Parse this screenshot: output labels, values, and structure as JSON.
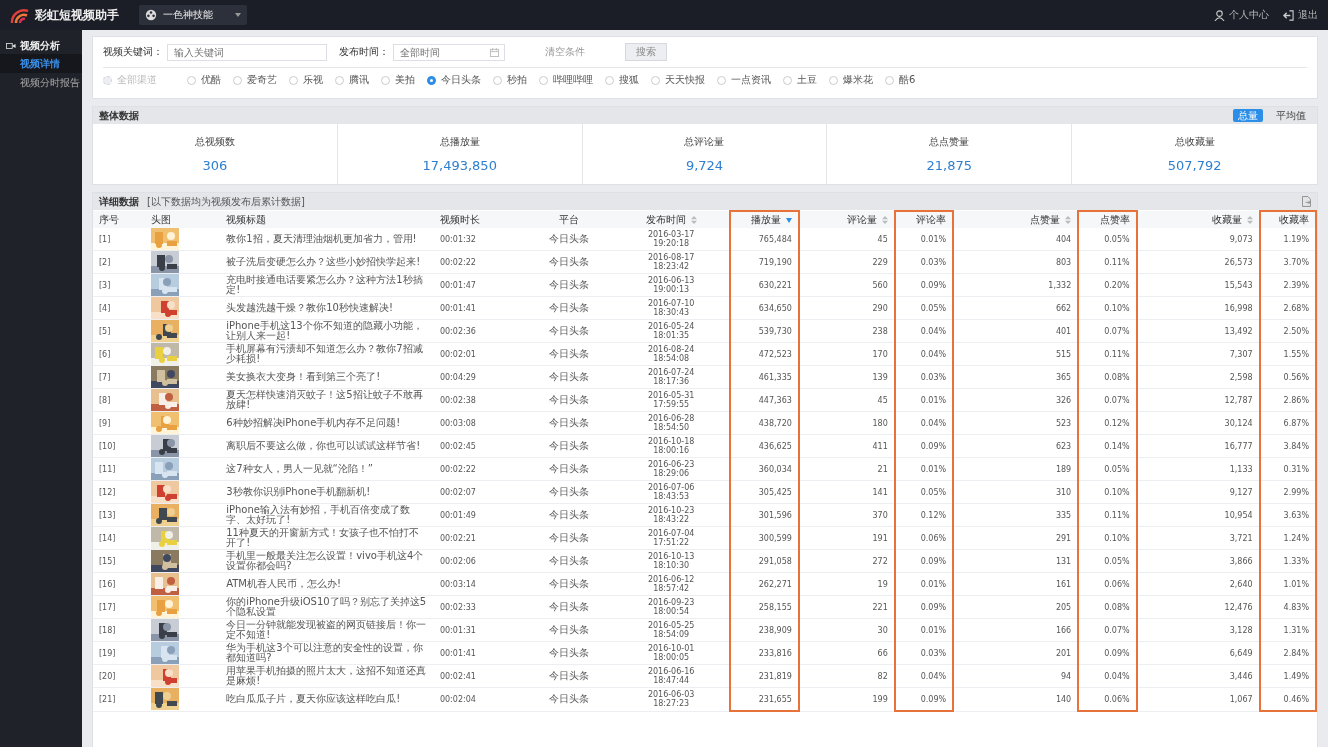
{
  "app": {
    "title": "彩虹短视频助手"
  },
  "account_select": {
    "value": "一色神技能"
  },
  "user_menu": [
    {
      "label": "个人中心",
      "kind": "user"
    },
    {
      "label": "退出",
      "kind": "logout"
    }
  ],
  "sidebar": {
    "section": "视频分析",
    "items": [
      {
        "label": "视频详情",
        "selected": true
      },
      {
        "label": "视频分时报告",
        "selected": false
      }
    ]
  },
  "filters": {
    "keyword_label": "视频关键词：",
    "keyword": {
      "placeholder": "输入关键词"
    },
    "date_label": "发布时间：",
    "date": {
      "placeholder": "全部时间"
    },
    "clear": "清空条件",
    "search": "搜索",
    "platforms": [
      {
        "label": "全部渠道",
        "selected": false,
        "disabled": true
      },
      {
        "label": "优酷",
        "selected": false,
        "disabled": false
      },
      {
        "label": "爱奇艺",
        "selected": false,
        "disabled": false
      },
      {
        "label": "乐视",
        "selected": false,
        "disabled": false
      },
      {
        "label": "腾讯",
        "selected": false,
        "disabled": false
      },
      {
        "label": "美拍",
        "selected": false,
        "disabled": false
      },
      {
        "label": "今日头条",
        "selected": true,
        "disabled": false
      },
      {
        "label": "秒拍",
        "selected": false,
        "disabled": false
      },
      {
        "label": "哔哩哔哩",
        "selected": false,
        "disabled": false
      },
      {
        "label": "搜狐",
        "selected": false,
        "disabled": false
      },
      {
        "label": "天天快报",
        "selected": false,
        "disabled": false
      },
      {
        "label": "一点资讯",
        "selected": false,
        "disabled": false
      },
      {
        "label": "土豆",
        "selected": false,
        "disabled": false
      },
      {
        "label": "爆米花",
        "selected": false,
        "disabled": false
      },
      {
        "label": "酷6",
        "selected": false,
        "disabled": false
      }
    ]
  },
  "overview": {
    "title": "整体数据",
    "modes": [
      {
        "label": "总量",
        "selected": true
      },
      {
        "label": "平均值",
        "selected": false
      }
    ],
    "stats": [
      {
        "label": "总视频数",
        "value": "306"
      },
      {
        "label": "总播放量",
        "value": "17,493,850"
      },
      {
        "label": "总评论量",
        "value": "9,724"
      },
      {
        "label": "总点赞量",
        "value": "21,875"
      },
      {
        "label": "总收藏量",
        "value": "507,792"
      }
    ]
  },
  "details": {
    "title": "详细数据",
    "note": "[以下数据均为视频发布后累计数据]",
    "columns": [
      {
        "label": "序号",
        "kind": "index",
        "highlighted": false
      },
      {
        "label": "头图",
        "kind": "thumb",
        "highlighted": false
      },
      {
        "label": "视频标题",
        "kind": "title",
        "highlighted": false
      },
      {
        "label": "视频时长",
        "kind": "text",
        "highlighted": false
      },
      {
        "label": "平台",
        "kind": "center",
        "highlighted": false
      },
      {
        "label": "发布时间",
        "kind": "date",
        "sortable": true,
        "sorted_desc": false,
        "highlighted": false
      },
      {
        "label": "播放量",
        "kind": "number",
        "sortable": true,
        "sorted_desc": true,
        "highlighted": true
      },
      {
        "label": "评论量",
        "kind": "number",
        "sortable": true,
        "sorted_desc": false,
        "highlighted": false
      },
      {
        "label": "评论率",
        "kind": "number",
        "highlighted": true
      },
      {
        "label": "点赞量",
        "kind": "number",
        "sortable": true,
        "sorted_desc": false,
        "highlighted": false
      },
      {
        "label": "点赞率",
        "kind": "number",
        "highlighted": true
      },
      {
        "label": "收藏量",
        "kind": "number",
        "sortable": true,
        "sorted_desc": false,
        "highlighted": false
      },
      {
        "label": "收藏率",
        "kind": "number",
        "highlighted": true
      }
    ],
    "rows": [
      {
        "cells": [
          "[1]",
          {
            "kind": "picture"
          },
          "教你1招，夏天清理油烟机更加省力，管用!",
          "00:01:32",
          "今日头条",
          "2016-03-17 19:20:18",
          "765,484",
          "45",
          "0.01%",
          "404",
          "0.05%",
          "9,073",
          "1.19%"
        ]
      },
      {
        "cells": [
          "[2]",
          {
            "kind": "picture"
          },
          "被子洗后变硬怎么办？这些小妙招快学起来!",
          "00:02:22",
          "今日头条",
          "2016-08-17 18:23:42",
          "719,190",
          "229",
          "0.03%",
          "803",
          "0.11%",
          "26,573",
          "3.70%"
        ]
      },
      {
        "cells": [
          "[3]",
          {
            "kind": "picture"
          },
          "充电时接通电话要紧怎么办？这种方法1秒搞定!",
          "00:01:47",
          "今日头条",
          "2016-06-13 19:00:13",
          "630,221",
          "560",
          "0.09%",
          "1,332",
          "0.20%",
          "15,543",
          "2.39%"
        ]
      },
      {
        "cells": [
          "[4]",
          {
            "kind": "picture"
          },
          "头发越洗越干燥？教你10秒快速解决!",
          "00:01:41",
          "今日头条",
          "2016-07-10 18:30:43",
          "634,650",
          "290",
          "0.05%",
          "662",
          "0.10%",
          "16,998",
          "2.68%"
        ]
      },
      {
        "cells": [
          "[5]",
          {
            "kind": "picture"
          },
          "iPhone手机这13个你不知道的隐藏小功能，让别人来一起!",
          "00:02:36",
          "今日头条",
          "2016-05-24 18:01:35",
          "539,730",
          "238",
          "0.04%",
          "401",
          "0.07%",
          "13,492",
          "2.50%"
        ]
      },
      {
        "cells": [
          "[6]",
          {
            "kind": "picture"
          },
          "手机屏幕有污渍却不知道怎么办？教你7招减少耗损!",
          "00:02:01",
          "今日头条",
          "2016-08-24 18:54:08",
          "472,523",
          "170",
          "0.04%",
          "515",
          "0.11%",
          "7,307",
          "1.55%"
        ]
      },
      {
        "cells": [
          "[7]",
          {
            "kind": "picture"
          },
          "美女换衣大变身！看到第三个亮了!",
          "00:04:29",
          "今日头条",
          "2016-07-24 18:17:36",
          "461,335",
          "139",
          "0.03%",
          "365",
          "0.08%",
          "2,598",
          "0.56%"
        ]
      },
      {
        "cells": [
          "[8]",
          {
            "kind": "picture"
          },
          "夏天怎样快速消灭蚊子！这5招让蚊子不敢再放肆!",
          "00:02:38",
          "今日头条",
          "2016-05-31 17:59:55",
          "447,363",
          "45",
          "0.01%",
          "326",
          "0.07%",
          "12,787",
          "2.86%"
        ]
      },
      {
        "cells": [
          "[9]",
          {
            "kind": "picture"
          },
          "6种妙招解决iPhone手机内存不足问题!",
          "00:03:08",
          "今日头条",
          "2016-06-28 18:54:50",
          "438,720",
          "180",
          "0.04%",
          "523",
          "0.12%",
          "30,124",
          "6.87%"
        ]
      },
      {
        "cells": [
          "[10]",
          {
            "kind": "picture"
          },
          "离职后不要这么做，你也可以试试这样节省!",
          "00:02:45",
          "今日头条",
          "2016-10-18 18:00:16",
          "436,625",
          "411",
          "0.09%",
          "623",
          "0.14%",
          "16,777",
          "3.84%"
        ]
      },
      {
        "cells": [
          "[11]",
          {
            "kind": "picture"
          },
          "这7种女人，男人一见就“沦陷！”",
          "00:02:22",
          "今日头条",
          "2016-06-23 18:29:06",
          "360,034",
          "21",
          "0.01%",
          "189",
          "0.05%",
          "1,133",
          "0.31%"
        ]
      },
      {
        "cells": [
          "[12]",
          {
            "kind": "picture"
          },
          "3秒教你识别iPhone手机翻新机!",
          "00:02:07",
          "今日头条",
          "2016-07-06 18:43:53",
          "305,425",
          "141",
          "0.05%",
          "310",
          "0.10%",
          "9,127",
          "2.99%"
        ]
      },
      {
        "cells": [
          "[13]",
          {
            "kind": "picture"
          },
          "iPhone输入法有妙招，手机百倍变成了数字、太好玩了!",
          "00:01:49",
          "今日头条",
          "2016-10-23 18:43:22",
          "301,596",
          "370",
          "0.12%",
          "335",
          "0.11%",
          "10,954",
          "3.63%"
        ]
      },
      {
        "cells": [
          "[14]",
          {
            "kind": "picture"
          },
          "11种夏天的开窗新方式！女孩子也不怕打不开了!",
          "00:02:21",
          "今日头条",
          "2016-07-04 17:51:22",
          "300,599",
          "191",
          "0.06%",
          "291",
          "0.10%",
          "3,721",
          "1.24%"
        ]
      },
      {
        "cells": [
          "[15]",
          {
            "kind": "picture"
          },
          "手机里一般最关注怎么设置！vivo手机这4个设置你都会吗?",
          "00:02:06",
          "今日头条",
          "2016-10-13 18:10:30",
          "291,058",
          "272",
          "0.09%",
          "131",
          "0.05%",
          "3,866",
          "1.33%"
        ]
      },
      {
        "cells": [
          "[16]",
          {
            "kind": "picture"
          },
          "ATM机吞人民币，怎么办!",
          "00:03:14",
          "今日头条",
          "2016-06-12 18:57:42",
          "262,271",
          "19",
          "0.01%",
          "161",
          "0.06%",
          "2,640",
          "1.01%"
        ]
      },
      {
        "cells": [
          "[17]",
          {
            "kind": "picture"
          },
          "你的iPhone升级iOS10了吗？别忘了关掉这5个隐私设置",
          "00:02:33",
          "今日头条",
          "2016-09-23 18:00:54",
          "258,155",
          "221",
          "0.09%",
          "205",
          "0.08%",
          "12,476",
          "4.83%"
        ]
      },
      {
        "cells": [
          "[18]",
          {
            "kind": "picture"
          },
          "今日一分钟就能发现被盗的网页链接后！你一定不知道!",
          "00:01:31",
          "今日头条",
          "2016-05-25 18:54:09",
          "238,909",
          "30",
          "0.01%",
          "166",
          "0.07%",
          "3,128",
          "1.31%"
        ]
      },
      {
        "cells": [
          "[19]",
          {
            "kind": "picture"
          },
          "华为手机这3个可以注意的安全性的设置，你都知道吗?",
          "00:01:41",
          "今日头条",
          "2016-10-01 18:00:05",
          "233,816",
          "66",
          "0.03%",
          "201",
          "0.09%",
          "6,649",
          "2.84%"
        ]
      },
      {
        "cells": [
          "[20]",
          {
            "kind": "picture"
          },
          "用苹果手机拍摄的照片太大，这招不知道还真是麻烦!",
          "00:02:41",
          "今日头条",
          "2016-06-16 18:47:44",
          "231,819",
          "82",
          "0.04%",
          "94",
          "0.04%",
          "3,446",
          "1.49%"
        ]
      },
      {
        "cells": [
          "[21]",
          {
            "kind": "picture"
          },
          "吃白瓜瓜子片，夏天你应该这样吃白瓜!",
          "00:02:04",
          "今日头条",
          "2016-06-03 18:27:23",
          "231,655",
          "199",
          "0.09%",
          "140",
          "0.06%",
          "1,067",
          "0.46%"
        ]
      }
    ]
  }
}
